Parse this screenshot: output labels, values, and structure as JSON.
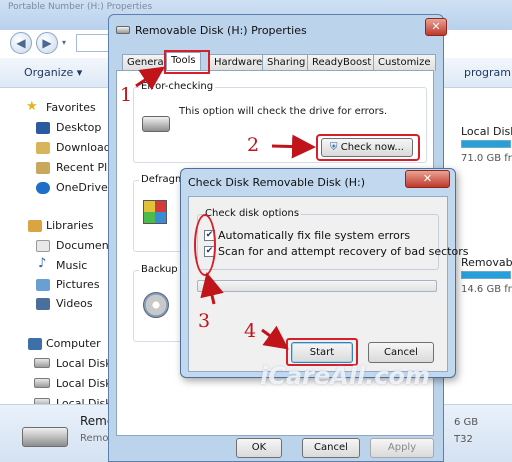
{
  "explorer": {
    "title": "Portable Number (H:) Properties",
    "organize_label": "Organize",
    "program_label": "program",
    "nav": {
      "favorites": "Favorites",
      "desktop": "Desktop",
      "downloads": "Download",
      "recent": "Recent Pla",
      "onedrive": "OneDrive",
      "libraries": "Libraries",
      "documents": "Documen",
      "music": "Music",
      "pictures": "Pictures",
      "videos": "Videos",
      "computer": "Computer",
      "local_disk_1": "Local Disk",
      "local_disk_2": "Local Disk",
      "local_disk_3": "Local Disk"
    },
    "content": {
      "local_disk": "Local Disk",
      "local_disk_free": "71.0 GB free",
      "removable": "Removable",
      "removable_free": "14.6 GB free"
    },
    "status": {
      "name": "Reme",
      "type": "Remo",
      "size": "6 GB",
      "fs": "T32"
    }
  },
  "properties_dialog": {
    "title": "Removable Disk (H:) Properties",
    "close_label": "✕",
    "tabs": [
      "General",
      "Tools",
      "Hardware",
      "Sharing",
      "ReadyBoost",
      "Customize"
    ],
    "error_checking_label": "Error-checking",
    "error_checking_desc": "This option will check the drive for errors.",
    "check_now_label": "Check now...",
    "defrag_label": "Defragm",
    "backup_label": "Backup",
    "ok_label": "OK",
    "cancel_label": "Cancel",
    "apply_label": "Apply"
  },
  "check_disk_dialog": {
    "title": "Check Disk Removable Disk (H:)",
    "close_label": "✕",
    "options_label": "Check disk options",
    "option_fix": "Automatically fix file system errors",
    "option_scan": "Scan for and attempt recovery of bad sectors",
    "option_fix_checked": true,
    "option_scan_checked": true,
    "progress": 0,
    "start_label": "Start",
    "cancel_label": "Cancel"
  },
  "annotations": {
    "step1": "1",
    "step2": "2",
    "step3": "3",
    "step4": "4",
    "watermark": "iCareAll.com",
    "accent_color": "#c0131a"
  }
}
